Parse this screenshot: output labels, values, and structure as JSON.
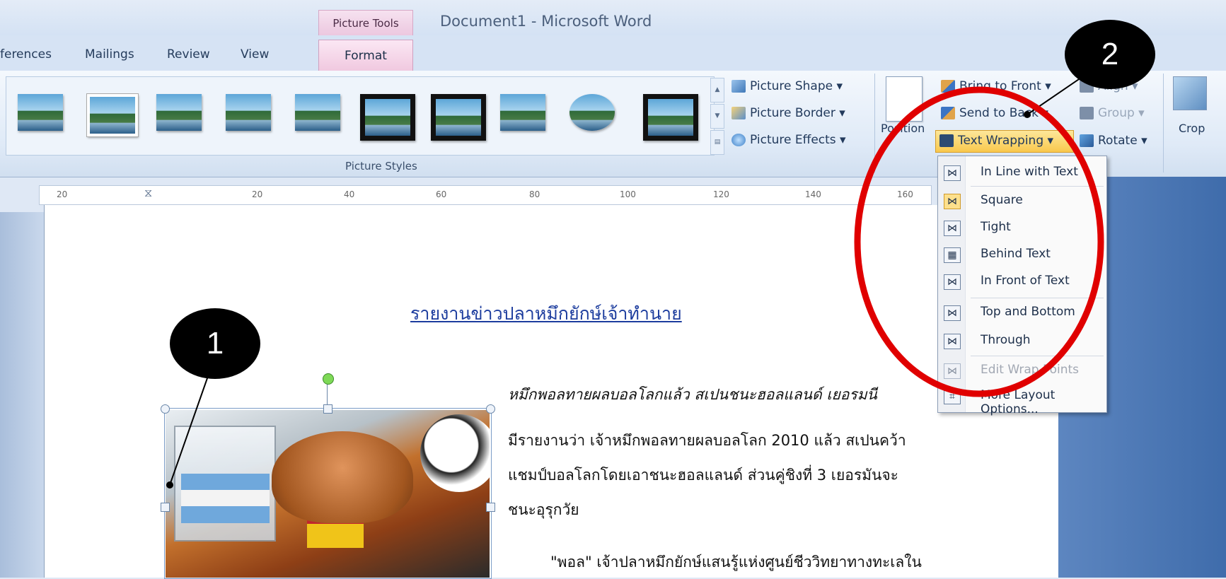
{
  "window": {
    "context_tab": "Picture Tools",
    "title": "Document1 - Microsoft Word"
  },
  "tabs": [
    "ferences",
    "Mailings",
    "Review",
    "View"
  ],
  "active_tab": "Format",
  "ribbon": {
    "picture_styles_label": "Picture Styles",
    "shape_label": "Picture Shape",
    "border_label": "Picture Border",
    "effects_label": "Picture Effects",
    "position_label": "Position",
    "bring_front_label": "Bring to Front",
    "send_back_label": "Send to Back",
    "text_wrapping_label": "Text Wrapping",
    "align_label": "Align",
    "group_label": "Group",
    "rotate_label": "Rotate",
    "crop_label": "Crop"
  },
  "ruler": [
    "20",
    "20",
    "40",
    "60",
    "80",
    "100",
    "120",
    "140",
    "160"
  ],
  "menu": {
    "items": [
      {
        "label": "In Line with Text",
        "icon": "wrap-inline-icon"
      },
      {
        "label": "Square",
        "icon": "wrap-square-icon",
        "active": true
      },
      {
        "label": "Tight",
        "icon": "wrap-tight-icon"
      },
      {
        "label": "Behind Text",
        "icon": "wrap-behind-icon"
      },
      {
        "label": "In Front of Text",
        "icon": "wrap-front-icon"
      },
      {
        "label": "Top and Bottom",
        "icon": "wrap-topbottom-icon"
      },
      {
        "label": "Through",
        "icon": "wrap-through-icon"
      },
      {
        "label": "Edit Wrap Points",
        "icon": "edit-wrap-points-icon",
        "disabled": true
      },
      {
        "label": "More Layout Options...",
        "icon": "layout-options-icon"
      }
    ]
  },
  "document": {
    "heading": "รายงานข่าวปลาหมึกยักษ์เจ้าทำนาย",
    "lines": [
      "หมึกพอลทายผลบอลโลกแล้ว สเปนชนะฮอลแลนด์ เยอรมนี",
      "มีรายงานว่า เจ้าหมึกพอลทายผลบอลโลก 2010 แล้ว สเปนคว้า",
      "แชมป์บอลโลกโดยเอาชนะฮอลแลนด์ ส่วนคู่ชิงที่ 3 เยอรมันจะ",
      "ชนะอุรุกวัย",
      "\"พอล\" เจ้าปลาหมึกยักษ์แสนรู้แห่งศูนย์ชีววิทยาทางทะเลใน"
    ]
  },
  "callouts": [
    "1",
    "2"
  ]
}
